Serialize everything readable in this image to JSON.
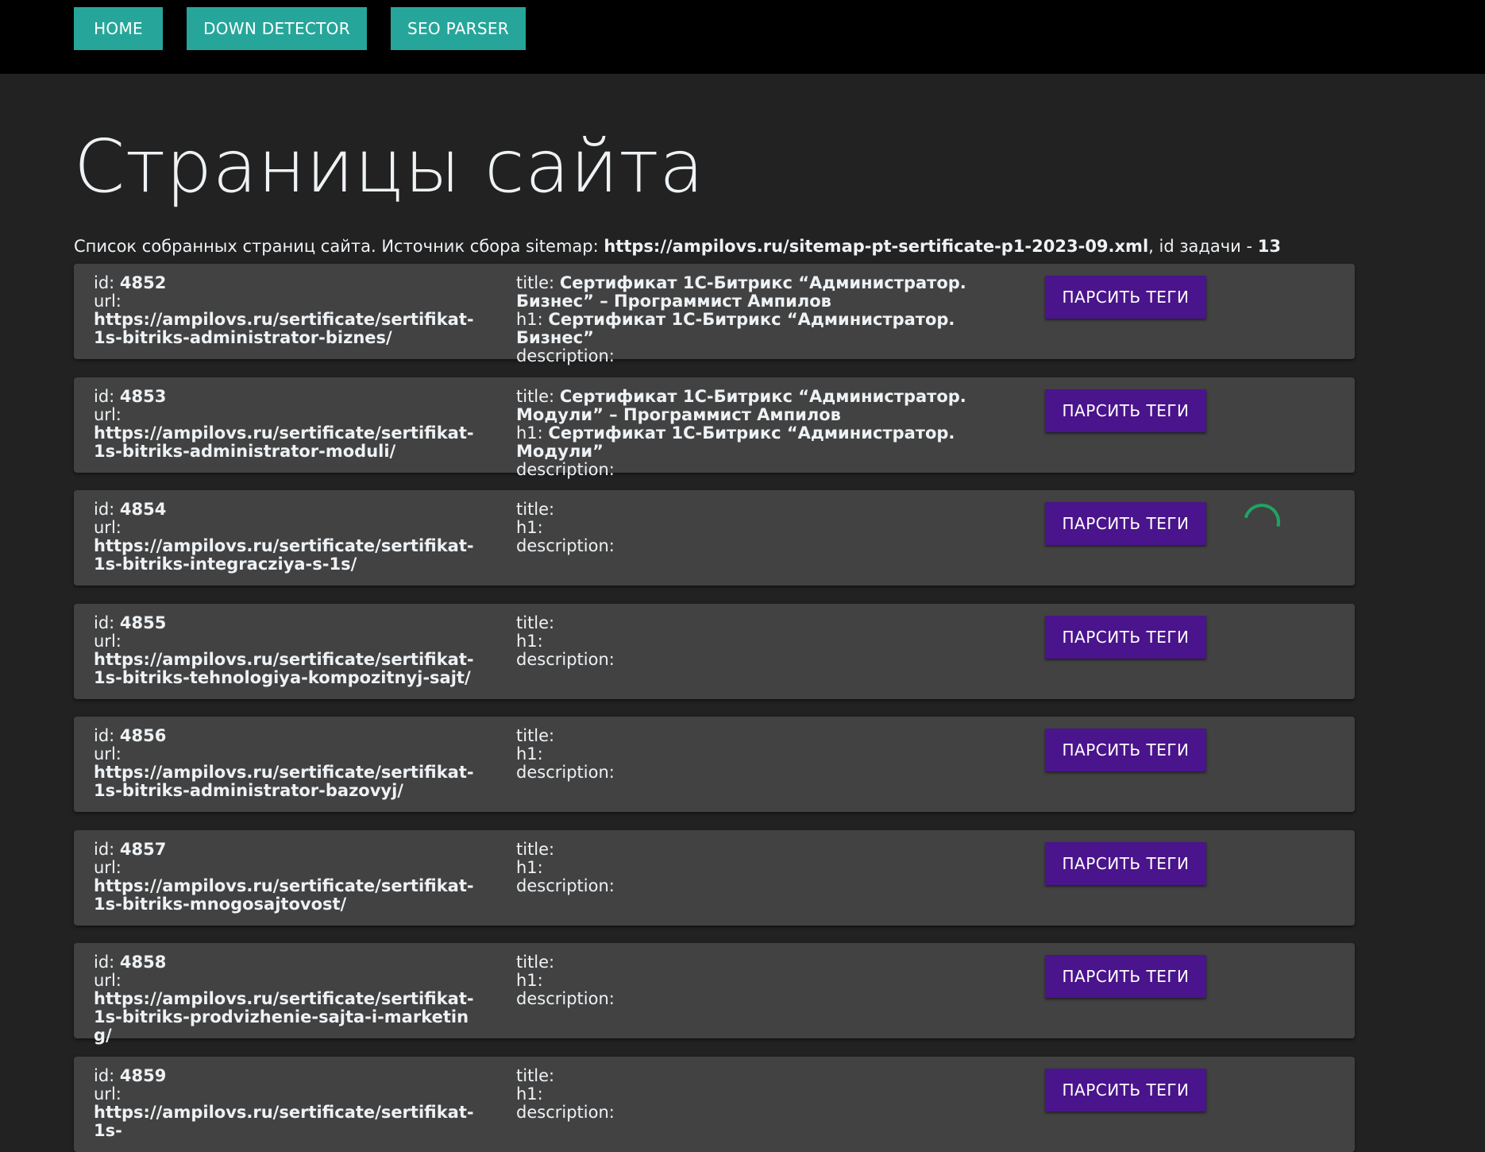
{
  "nav": {
    "home": "HOME",
    "down_detector": "DOWN DETECTOR",
    "seo_parser": "SEO PARSER"
  },
  "page": {
    "title": "Страницы сайта",
    "intro_prefix": "Список собранных страниц сайта. Источник сбора sitemap: ",
    "sitemap_url": "https://ampilovs.ru/sitemap-pt-sertificate-p1-2023-09.xml",
    "task_label": ", id задачи - ",
    "task_id": "13"
  },
  "labels": {
    "id": "id: ",
    "url": "url:",
    "title": "title: ",
    "h1": "h1: ",
    "description": "description:",
    "parse_button": "ПАРСИТЬ ТЕГИ"
  },
  "colors": {
    "nav_button": "#26a69a",
    "parse_button": "#4a148c",
    "card_bg": "#424242",
    "spinner": "#1fa463"
  },
  "pages": [
    {
      "id": "4852",
      "url": "https://ampilovs.ru/sertificate/sertifikat-1s-bitriks-administrator-biznes/",
      "title": "Сертификат 1С-Битрикс “Администратор. Бизнес” – Программист Ампилов",
      "h1": "Сертификат 1С-Битрикс “Администратор. Бизнес”",
      "description": "",
      "loading": false
    },
    {
      "id": "4853",
      "url": "https://ampilovs.ru/sertificate/sertifikat-1s-bitriks-administrator-moduli/",
      "title": "Сертификат 1С-Битрикс “Администратор. Модули” – Программист Ампилов",
      "h1": "Сертификат 1С-Битрикс “Администратор. Модули”",
      "description": "",
      "loading": false
    },
    {
      "id": "4854",
      "url": "https://ampilovs.ru/sertificate/sertifikat-1s-bitriks-integracziya-s-1s/",
      "title": "",
      "h1": "",
      "description": "",
      "loading": true
    },
    {
      "id": "4855",
      "url": "https://ampilovs.ru/sertificate/sertifikat-1s-bitriks-tehnologiya-kompozitnyj-sajt/",
      "title": "",
      "h1": "",
      "description": "",
      "loading": false
    },
    {
      "id": "4856",
      "url": "https://ampilovs.ru/sertificate/sertifikat-1s-bitriks-administrator-bazovyj/",
      "title": "",
      "h1": "",
      "description": "",
      "loading": false
    },
    {
      "id": "4857",
      "url": "https://ampilovs.ru/sertificate/sertifikat-1s-bitriks-mnogosajtovost/",
      "title": "",
      "h1": "",
      "description": "",
      "loading": false
    },
    {
      "id": "4858",
      "url": "https://ampilovs.ru/sertificate/sertifikat-1s-bitriks-prodvizhenie-sajta-i-marketing/",
      "title": "",
      "h1": "",
      "description": "",
      "loading": false
    },
    {
      "id": "4859",
      "url": "https://ampilovs.ru/sertificate/sertifikat-1s-",
      "title": "",
      "h1": "",
      "description": "",
      "loading": false
    }
  ]
}
